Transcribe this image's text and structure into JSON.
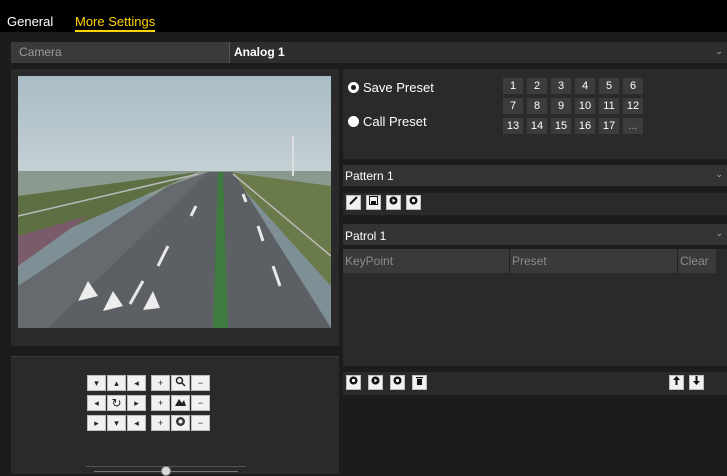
{
  "tabs": {
    "general": "General",
    "more_settings": "More Settings"
  },
  "camera": {
    "label": "Camera",
    "value": "Analog 1"
  },
  "preset": {
    "save_label": "Save Preset",
    "call_label": "Call Preset",
    "selected": "save",
    "numbers": [
      "1",
      "2",
      "3",
      "4",
      "5",
      "6",
      "7",
      "8",
      "9",
      "10",
      "11",
      "12",
      "13",
      "14",
      "15",
      "16",
      "17",
      "..."
    ]
  },
  "pattern": {
    "value": "Pattern 1"
  },
  "patrol": {
    "value": "Patrol 1",
    "columns": [
      "KeyPoint",
      "Preset",
      "Clear"
    ]
  },
  "ptz": {
    "speed_level": 0.5,
    "glyphs": {
      "up_left": "▾",
      "up": "▴",
      "up_right": "◂",
      "left": "◂",
      "auto": "↻",
      "right": "▸",
      "down_left": "▸",
      "down": "▾",
      "down_right": "◂",
      "zoom_plus": "+",
      "zoom_minus": "−",
      "focus_plus": "+",
      "focus_minus": "−",
      "iris_plus": "+",
      "iris_minus": "−"
    },
    "icons": [
      "zoom-icon",
      "focus-icon",
      "iris-icon"
    ]
  },
  "colors": {
    "accent": "#ffd400",
    "panel": "#2a2a2a",
    "background": "#1c1c1c"
  }
}
